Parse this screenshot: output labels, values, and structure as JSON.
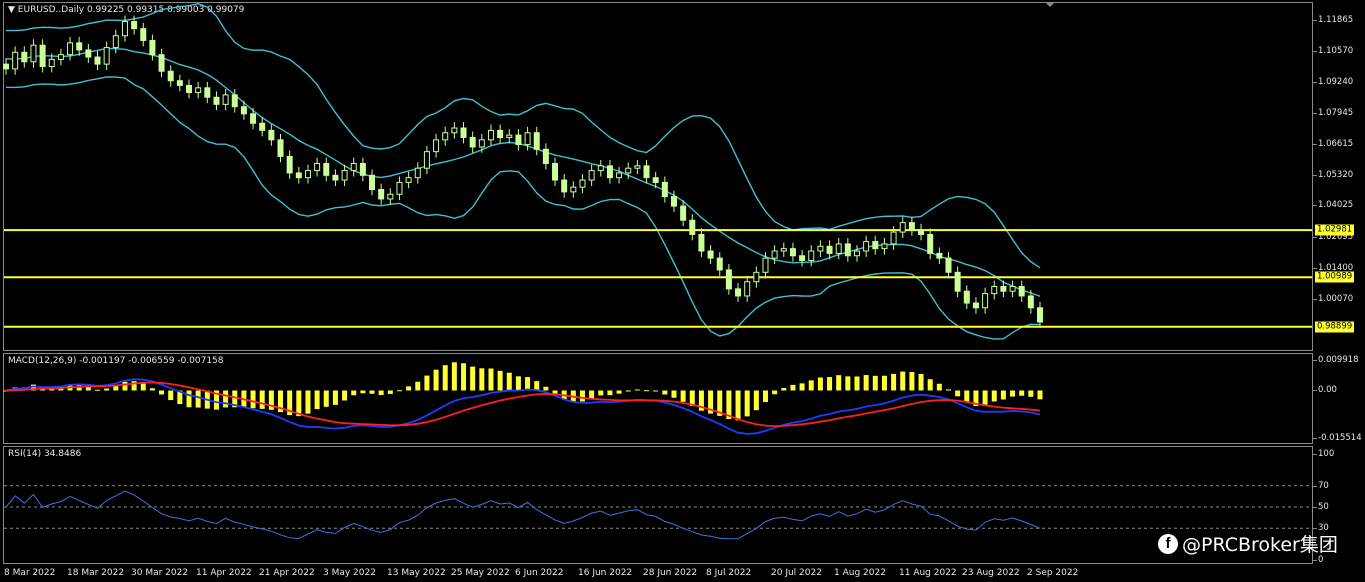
{
  "window": {
    "symbol_title": "EURUSD..Daily",
    "ohlc": "0.99225 0.99315 0.99003 0.99079"
  },
  "price_axis": {
    "ticks": [
      "1.11865",
      "1.10570",
      "1.09240",
      "1.07945",
      "1.06615",
      "1.05320",
      "1.04025",
      "1.02695",
      "1.01400",
      "1.00070"
    ],
    "levels": [
      {
        "label": "1.02981",
        "value": 1.02981
      },
      {
        "label": "1.00989",
        "value": 1.00989
      },
      {
        "label": "0.98899",
        "value": 0.98899
      }
    ]
  },
  "macd": {
    "label": "MACD(12,26,9) -0.001197 -0.006559 -0.007158",
    "ticks": [
      "0.009918",
      "0.00",
      "-0.015514"
    ]
  },
  "rsi": {
    "label": "RSI(14) 34.8486",
    "ticks": [
      "100",
      "70",
      "50",
      "30",
      "0"
    ]
  },
  "time_axis": [
    "8 Mar 2022",
    "18 Mar 2022",
    "30 Mar 2022",
    "11 Apr 2022",
    "21 Apr 2022",
    "3 May 2022",
    "13 May 2022",
    "25 May 2022",
    "6 Jun 2022",
    "16 Jun 2022",
    "28 Jun 2022",
    "8 Jul 2022",
    "20 Jul 2022",
    "1 Aug 2022",
    "11 Aug 2022",
    "23 Aug 2022",
    "2 Sep 2022"
  ],
  "watermark": {
    "icon": "facebook-icon",
    "text": "@PRCBroker集团"
  },
  "colors": {
    "candle": "#ccff99",
    "bollinger": "#40c0d0",
    "level_line": "#ffff33",
    "macd_hist": "#ffff33",
    "macd_line": "#1e3cff",
    "signal_line": "#ff2020",
    "rsi_line": "#3c74e0",
    "grid": "#8a8a8a"
  },
  "chart_data": {
    "type": "candlestick",
    "title": "EURUSD..Daily",
    "price_ylim": [
      0.98,
      1.125
    ],
    "close_series": [
      1.098,
      1.105,
      1.101,
      1.108,
      1.099,
      1.102,
      1.104,
      1.109,
      1.106,
      1.103,
      1.1,
      1.107,
      1.112,
      1.118,
      1.115,
      1.11,
      1.104,
      1.097,
      1.093,
      1.091,
      1.088,
      1.09,
      1.086,
      1.083,
      1.087,
      1.082,
      1.079,
      1.075,
      1.072,
      1.068,
      1.061,
      1.054,
      1.052,
      1.055,
      1.058,
      1.053,
      1.051,
      1.055,
      1.058,
      1.053,
      1.047,
      1.043,
      1.045,
      1.05,
      1.052,
      1.056,
      1.063,
      1.068,
      1.071,
      1.073,
      1.069,
      1.065,
      1.068,
      1.072,
      1.069,
      1.07,
      1.066,
      1.071,
      1.064,
      1.058,
      1.051,
      1.046,
      1.048,
      1.051,
      1.055,
      1.057,
      1.052,
      1.054,
      1.056,
      1.057,
      1.052,
      1.05,
      1.044,
      1.04,
      1.034,
      1.028,
      1.021,
      1.018,
      1.013,
      1.005,
      1.002,
      1.008,
      1.012,
      1.018,
      1.021,
      1.022,
      1.019,
      1.017,
      1.021,
      1.023,
      1.02,
      1.024,
      1.019,
      1.021,
      1.025,
      1.022,
      1.024,
      1.029,
      1.033,
      1.03,
      1.028,
      1.02,
      1.018,
      1.012,
      1.004,
      0.999,
      0.997,
      1.003,
      1.006,
      1.004,
      1.006,
      1.002,
      0.997,
      0.991
    ]
  }
}
